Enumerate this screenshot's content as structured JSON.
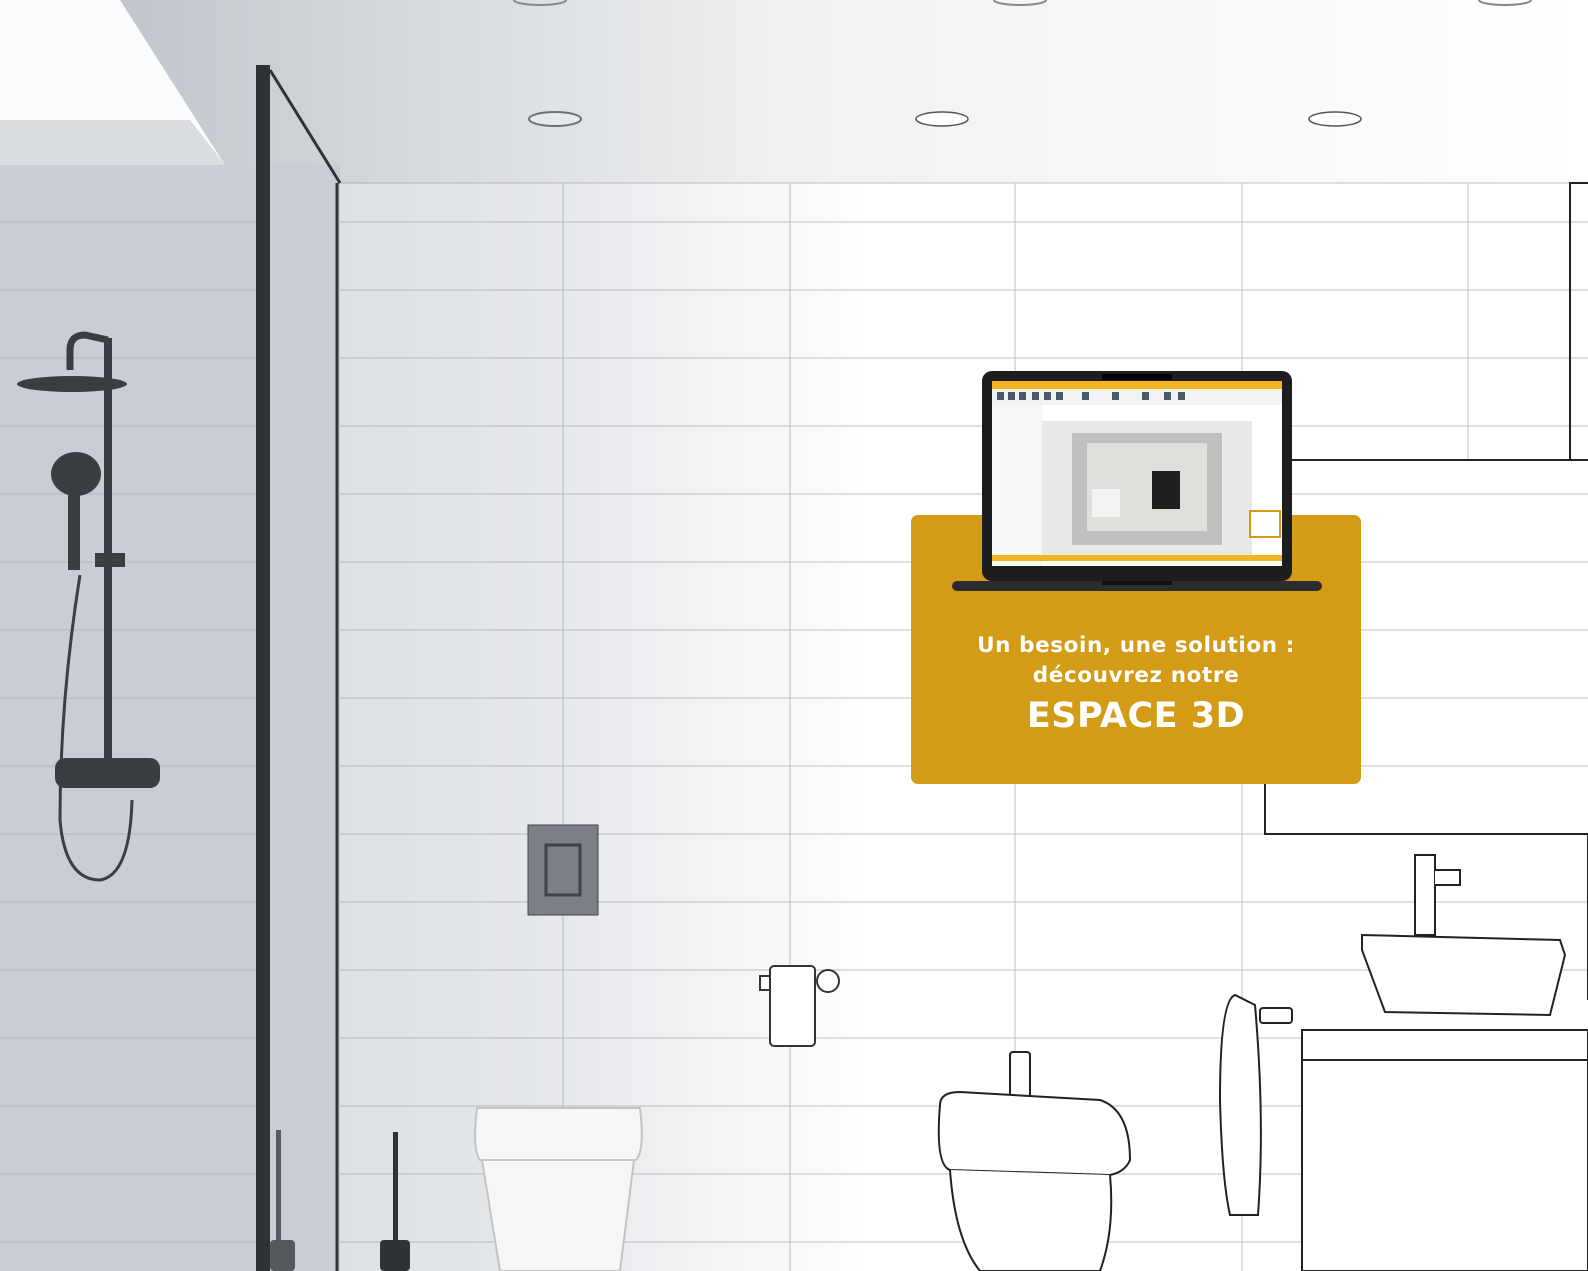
{
  "promo": {
    "line1": "Un besoin, une solution :",
    "line2": "découvrez notre",
    "cta": "ESPACE 3D",
    "color": "#d49c16"
  },
  "icons": [
    "laptop-mockup-image",
    "shower-column-image",
    "toilet-image",
    "bidet-image",
    "basin-image"
  ]
}
